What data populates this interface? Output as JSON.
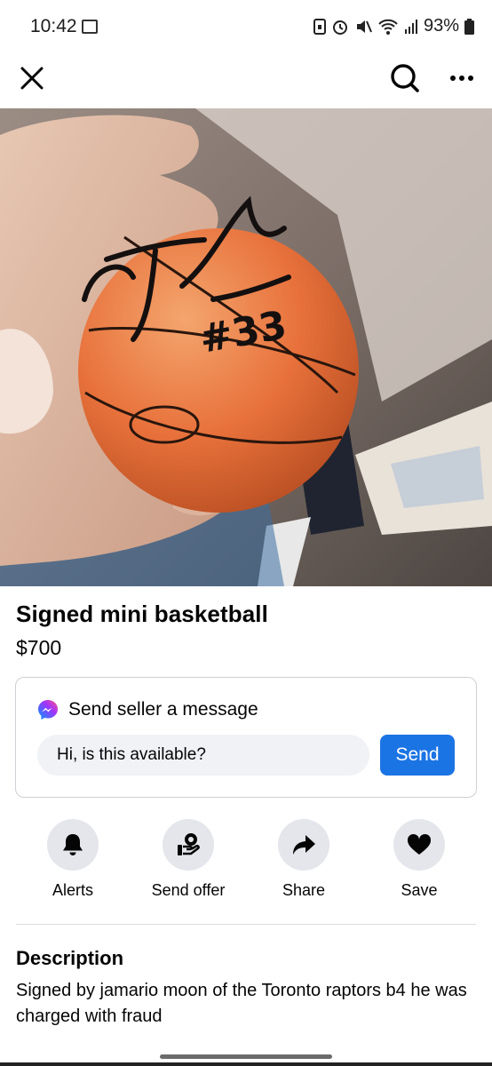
{
  "status_bar": {
    "time": "10:42",
    "battery": "93%"
  },
  "app_bar": {
    "close_icon": "close-icon",
    "search_icon": "search-icon",
    "more_icon": "more-horizontal-icon"
  },
  "listing": {
    "photo_description_icon": "product-photo",
    "title": "Signed mini basketball",
    "price": "$700"
  },
  "message_card": {
    "heading": "Send seller a message",
    "input_value": "Hi, is this available?",
    "send_label": "Send",
    "accent_color": "#1b74e4"
  },
  "actions": [
    {
      "label": "Alerts",
      "icon": "bell-icon"
    },
    {
      "label": "Send offer",
      "icon": "offer-icon"
    },
    {
      "label": "Share",
      "icon": "share-icon"
    },
    {
      "label": "Save",
      "icon": "heart-icon"
    }
  ],
  "description": {
    "heading": "Description",
    "text": "Signed by jamario moon of the Toronto raptors b4 he was charged with fraud"
  }
}
